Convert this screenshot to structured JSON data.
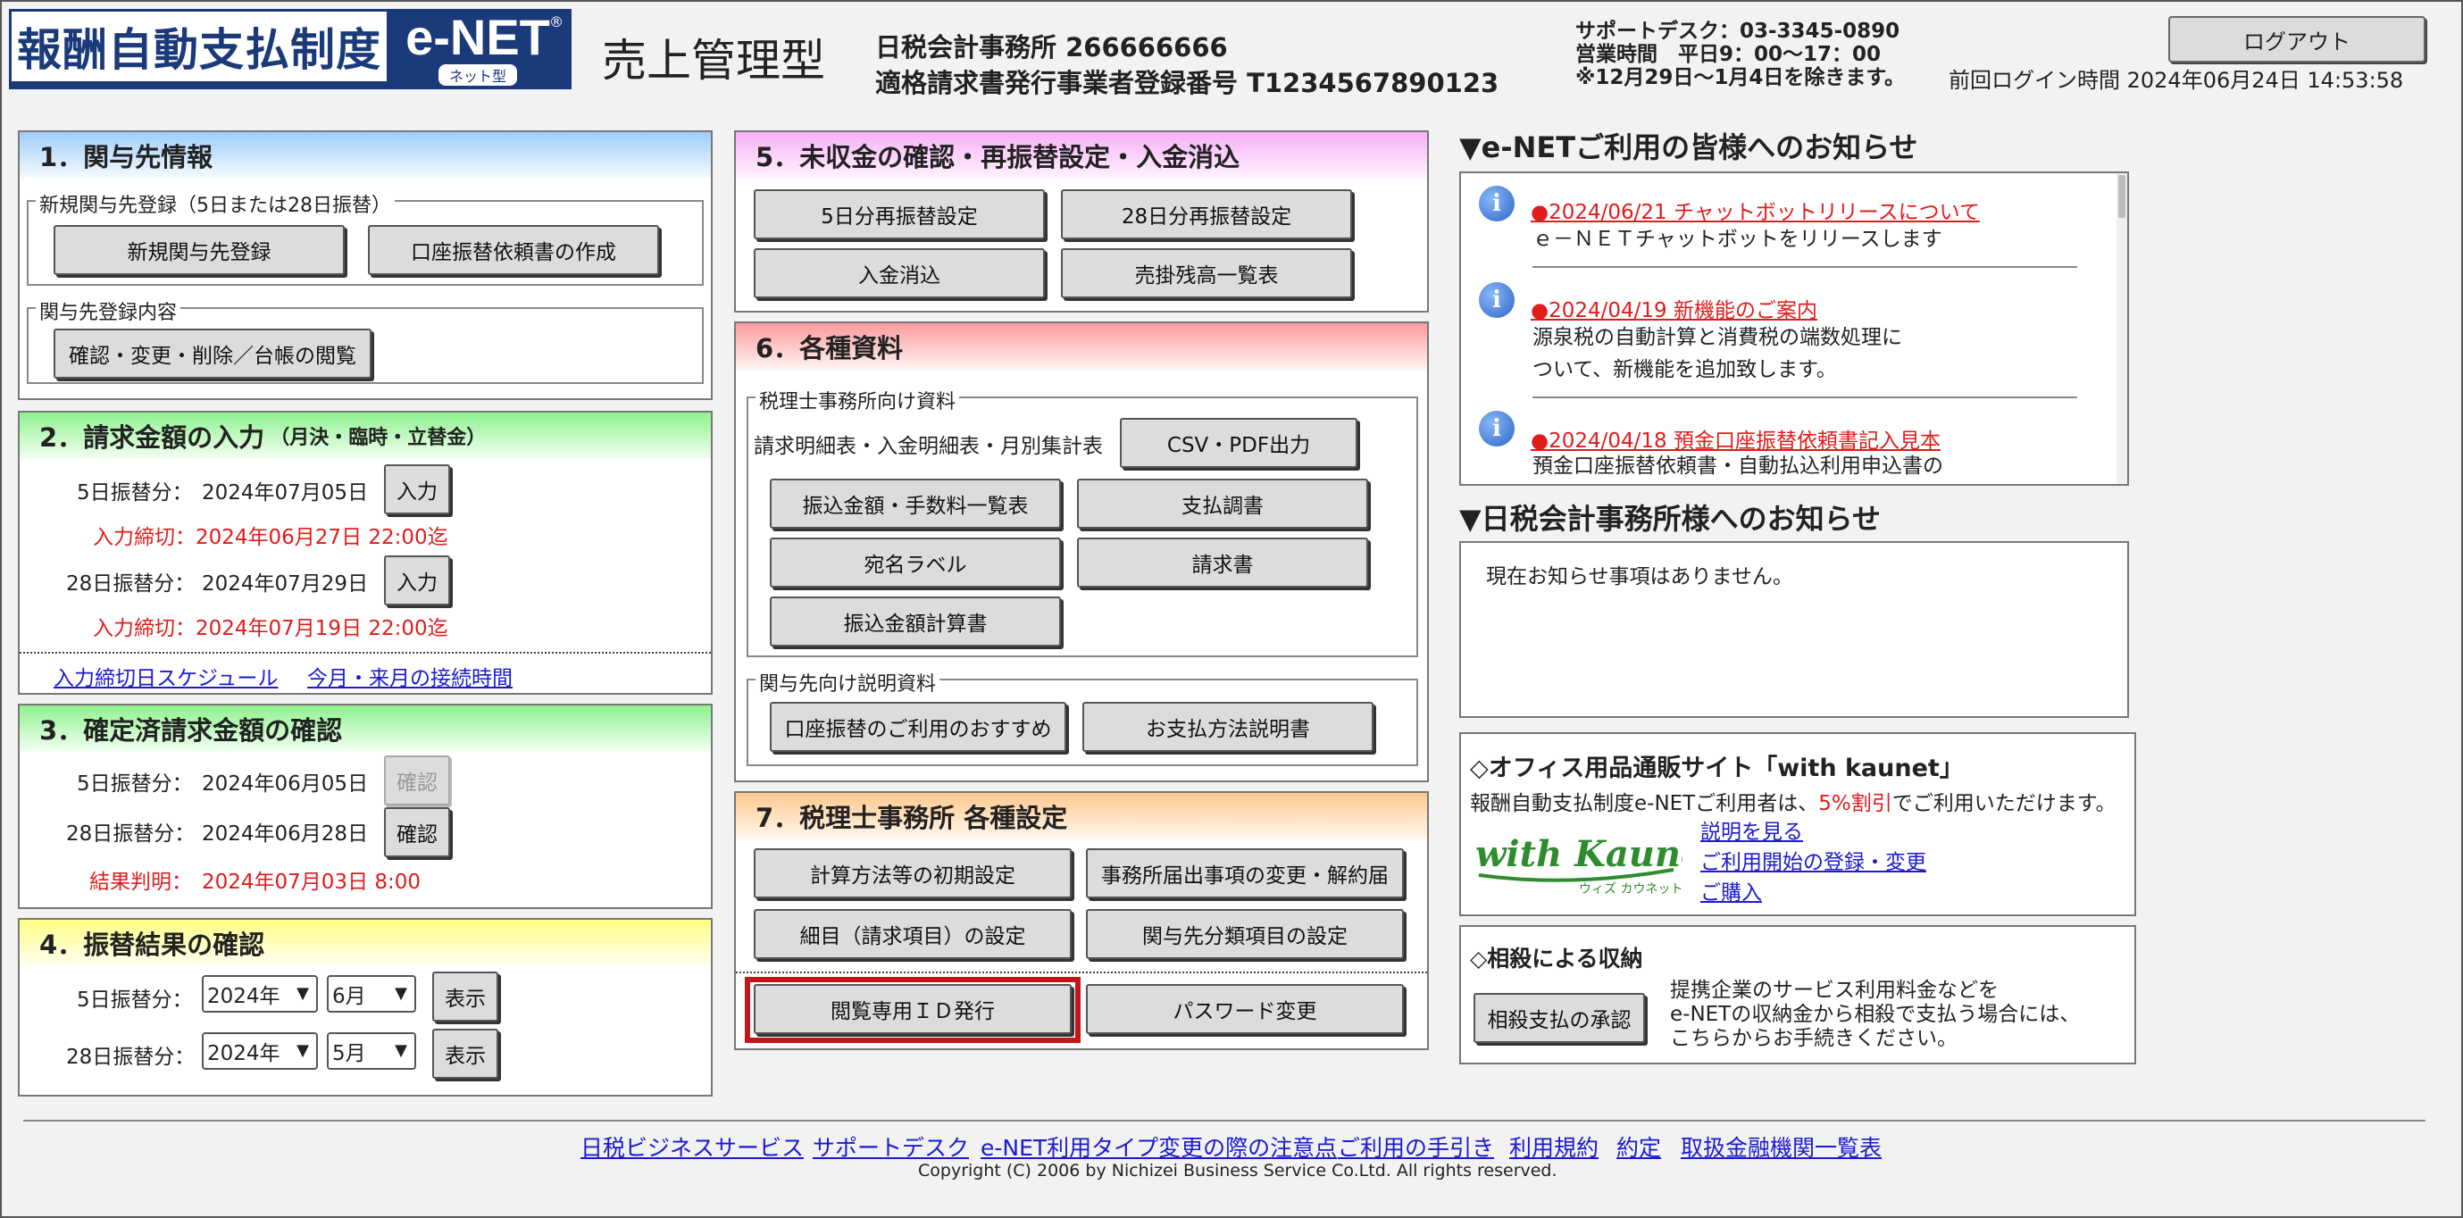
{
  "header": {
    "logo_main": "報酬自動支払制度",
    "logo_enet": "e-NET",
    "logo_reg": "®",
    "logo_sub": "ネット型",
    "service_type": "売上管理型",
    "office": "日税会計事務所 266666666",
    "registration": "適格請求書発行事業者登録番号 T1234567890123",
    "support_line1": "サポートデスク：03-3345-0890",
    "support_line2": "営業時間　平日9：00～17：00",
    "support_line3": "※12月29日～1月4日を除きます。",
    "logout_label": "ログアウト",
    "last_login": "前回ログイン時間 2024年06月24日 14:53:58"
  },
  "s1": {
    "title": "1．関与先情報",
    "fs1_legend": "新規関与先登録（5日または28日振替）",
    "btn_new": "新規関与先登録",
    "btn_account": "口座振替依頼書の作成",
    "fs2_legend": "関与先登録内容",
    "btn_view": "確認・変更・削除／台帳の閲覧"
  },
  "s2": {
    "title": "2．請求金額の入力",
    "title_small": "（月決・臨時・立替金）",
    "row1_label": "5日振替分：",
    "row1_date": "2024年07月05日",
    "row1_btn": "入力",
    "row1_deadline": "入力締切：2024年06月27日 22:00迄",
    "row2_label": "28日振替分：",
    "row2_date": "2024年07月29日",
    "row2_btn": "入力",
    "row2_deadline": "入力締切：2024年07月19日 22:00迄",
    "link_schedule": "入力締切日スケジュール",
    "link_hours": "今月・来月の接続時間"
  },
  "s3": {
    "title": "3．確定済請求金額の確認",
    "row1_label": "5日振替分：",
    "row1_date": "2024年06月05日",
    "row1_btn": "確認",
    "row2_label": "28日振替分：",
    "row2_date": "2024年06月28日",
    "row2_btn": "確認",
    "result": "結果判明：",
    "result_date": "2024年07月03日 8:00"
  },
  "s4": {
    "title": "4．振替結果の確認",
    "row1_label": "5日振替分：",
    "row1_year": "2024年",
    "row1_month": "6月",
    "row1_btn": "表示",
    "row2_label": "28日振替分：",
    "row2_year": "2024年",
    "row2_month": "5月",
    "row2_btn": "表示"
  },
  "s5": {
    "title": "5．未収金の確認・再振替設定・入金消込",
    "btn1": "5日分再振替設定",
    "btn2": "28日分再振替設定",
    "btn3": "入金消込",
    "btn4": "売掛残高一覧表"
  },
  "s6": {
    "title": "6．各種資料",
    "fs1_legend": "税理士事務所向け資料",
    "report_label": "請求明細表・入金明細表・月別集計表",
    "btn_csv": "CSV・PDF出力",
    "btn_fee": "振込金額・手数料一覧表",
    "btn_pay": "支払調書",
    "btn_label": "宛名ラベル",
    "btn_invoice": "請求書",
    "btn_calc": "振込金額計算書",
    "fs2_legend": "関与先向け説明資料",
    "btn_recommend": "口座振替のご利用のおすすめ",
    "btn_method": "お支払方法説明書"
  },
  "s7": {
    "title": "7．税理士事務所 各種設定",
    "btn_init": "計算方法等の初期設定",
    "btn_change": "事務所届出事項の変更・解約届",
    "btn_detail": "細目（請求項目）の設定",
    "btn_category": "関与先分類項目の設定",
    "btn_viewid": "閲覧専用ＩＤ発行",
    "btn_password": "パスワード変更"
  },
  "news": {
    "heading": "▼e-NETご利用の皆様へのお知らせ",
    "items": [
      {
        "title": "●2024/06/21 チャットボットリリースについて",
        "body1": "ｅ－ＮＥＴチャットボットをリリースします",
        "body2": ""
      },
      {
        "title": "●2024/04/19 新機能のご案内",
        "body1": "源泉税の自動計算と消費税の端数処理に",
        "body2": "ついて、新機能を追加致します。"
      },
      {
        "title": "●2024/04/18 預金口座振替依頼書記入見本",
        "body1": "預金口座振替依頼書・自動払込利用申込書の",
        "body2": ""
      }
    ]
  },
  "office_news": {
    "heading": "▼日税会計事務所様へのお知らせ",
    "body": "現在お知らせ事項はありません。"
  },
  "kaunet": {
    "heading": "◇オフィス用品通販サイト「with kaunet」",
    "desc_pre": "報酬自動支払制度e-NETご利用者は、",
    "desc_red": "5%割引",
    "desc_post": "でご利用いただけます。",
    "logo_main": "with Kaunet",
    "logo_sub": "ウィズ カウネット",
    "link1": "説明を見る",
    "link2": "ご利用開始の登録・変更",
    "link3": "ご購入"
  },
  "offset": {
    "heading": "◇相殺による収納",
    "btn": "相殺支払の承認",
    "line1": "提携企業のサービス利用料金などを",
    "line2": "e-NETの収納金から相殺で支払う場合には、",
    "line3": "こちらからお手続きください。"
  },
  "footer": {
    "links": [
      "日税ビジネスサービス",
      "サポートデスク",
      "e-NET利用タイプ変更の際の注意点",
      "ご利用の手引き",
      "利用規約",
      "約定",
      "取扱金融機関一覧表"
    ],
    "copyright": "Copyright (C) 2006 by Nichizei Business Service Co.Ltd. All rights reserved."
  },
  "colors": {
    "brand": "#1a3a7a",
    "deadline_red": "#e21b1b",
    "highlight_border": "#c0181a",
    "link_blue": "#1a1ad0"
  }
}
